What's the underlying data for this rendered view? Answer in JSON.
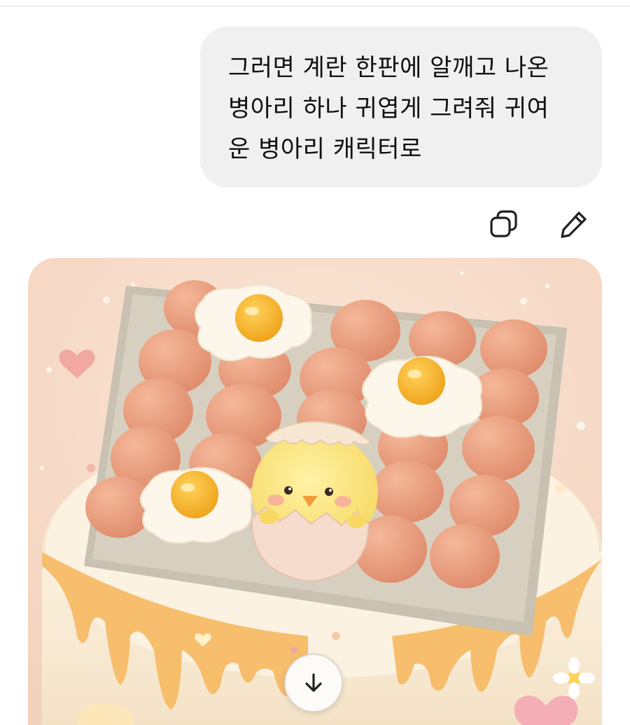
{
  "message": {
    "lines": [
      "그러면 계란 한판에 알깨고 나온",
      "병아리 하나 귀엽게 그려줘 귀여",
      "운 병아리 캐릭터로"
    ]
  },
  "actions": {
    "copy_icon": "copy-icon",
    "edit_icon": "pencil-icon"
  },
  "image": {
    "description_icon": "generated-image",
    "scroll_icon": "arrow-down-icon"
  },
  "colors": {
    "bubble": "#f0f0f0",
    "text": "#111111",
    "icon": "#222222"
  }
}
